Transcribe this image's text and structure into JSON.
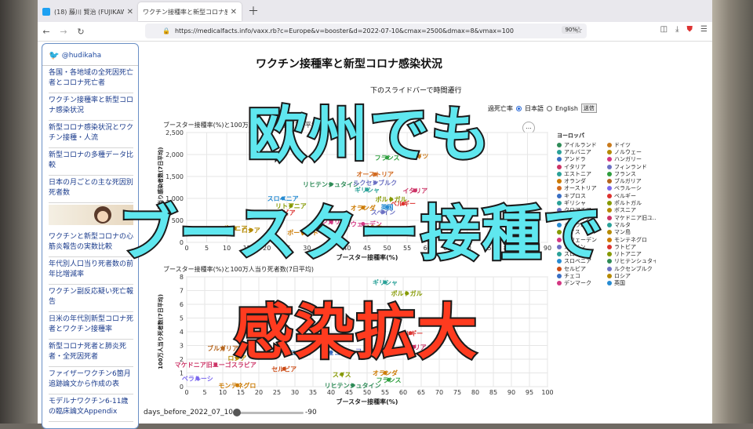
{
  "browser": {
    "tabs": [
      {
        "label": "(18) 藤川 賢治 (FUJIKAWA Kenji",
        "icon": "twitter-icon",
        "color": "#1da1f2"
      },
      {
        "label": "ワクチン接種率と新型コロナ感染状況",
        "icon": "page-icon",
        "color": "#888888"
      }
    ],
    "url": "https://medicalfacts.info/vaxx.rb?c=Europe&v=booster&d=2022-07-10&cmax=2500&dmax=8&vmax=100",
    "zoom": "90%"
  },
  "sidebar": {
    "twitter_handle": "@hudikaha",
    "links": [
      "各国・各地域の全死因死亡者とコロナ死亡者",
      "ワクチン接種率と新型コロナ感染状況",
      "新型コロナ感染状況とワクチン接種・人流",
      "新型コロナの多種データ比較",
      "日本の月ごとの主な死因別死者数",
      "ワクチンと新型コロナの心筋炎報告の実数比較",
      "年代別人口当り死者数の前年比増減率",
      "ワクチン副反応疑い死亡報告",
      "日米の年代別新型コロナ死者とワクチン接種率",
      "新型コロナ死者と肺炎死者・全死因死者",
      "ファイザーワクチン6箇月追跡論文から作成の表",
      "モデルナワクチン6-11歳の臨床論文Appendix"
    ]
  },
  "page": {
    "title": "ワクチン接種率と新型コロナ感染状況",
    "slider_caption": "下のスライドバーで時間遷行",
    "form_label": "過死亡率",
    "lang_ja": "日本語",
    "lang_en": "English",
    "submit": "送信",
    "slider_label": "days_before_2022_07_10",
    "slider_value": "-90",
    "slider_position": 0.0,
    "more_icon": "..."
  },
  "legend": {
    "title": "ヨーロッパ",
    "items": [
      {
        "name": "アイルランド",
        "color": "#2e8b57"
      },
      {
        "name": "ドイツ",
        "color": "#c97a1c"
      },
      {
        "name": "アルバニア",
        "color": "#2aa198"
      },
      {
        "name": "ノルウェー",
        "color": "#b58900"
      },
      {
        "name": "アンドラ",
        "color": "#3a6fc4"
      },
      {
        "name": "ハンガリー",
        "color": "#d33682"
      },
      {
        "name": "イタリア",
        "color": "#cc3366"
      },
      {
        "name": "フィンランド",
        "color": "#6c71c4"
      },
      {
        "name": "エストニア",
        "color": "#2aa198"
      },
      {
        "name": "フランス",
        "color": "#2e9e3e"
      },
      {
        "name": "オランダ",
        "color": "#cc7a00"
      },
      {
        "name": "ブルガリア",
        "color": "#b5651d"
      },
      {
        "name": "オーストリア",
        "color": "#d2691e"
      },
      {
        "name": "ベラルーシ",
        "color": "#7b68ee"
      },
      {
        "name": "キプロス",
        "color": "#3a6fc4"
      },
      {
        "name": "ベルギー",
        "color": "#dc322f"
      },
      {
        "name": "ギリシャ",
        "color": "#2aa198"
      },
      {
        "name": "ポルトガル",
        "color": "#859900"
      },
      {
        "name": "クロアチア",
        "color": "#6c71c4"
      },
      {
        "name": "ボスニア",
        "color": "#b58900"
      },
      {
        "name": "サンマリノ",
        "color": "#cb4b16"
      },
      {
        "name": "マケドニア旧ユ...",
        "color": "#cc3366"
      },
      {
        "name": "ジブラルタル",
        "color": "#268bd2"
      },
      {
        "name": "マルタ",
        "color": "#2aa198"
      },
      {
        "name": "スイス",
        "color": "#859900"
      },
      {
        "name": "マン島",
        "color": "#b58900"
      },
      {
        "name": "スウェーデン",
        "color": "#d33682"
      },
      {
        "name": "モンテネグロ",
        "color": "#cc7a00"
      },
      {
        "name": "スペイン",
        "color": "#6c71c4"
      },
      {
        "name": "ラトビア",
        "color": "#dc322f"
      },
      {
        "name": "スロバキア",
        "color": "#2aa198"
      },
      {
        "name": "リトアニア",
        "color": "#859900"
      },
      {
        "name": "スロベニア",
        "color": "#268bd2"
      },
      {
        "name": "リヒテンシュタイ...",
        "color": "#2e8b57"
      },
      {
        "name": "セルビア",
        "color": "#cb4b16"
      },
      {
        "name": "ルクセンブルク",
        "color": "#6c71c4"
      },
      {
        "name": "チェコ",
        "color": "#3a6fc4"
      },
      {
        "name": "ロシア",
        "color": "#b58900"
      },
      {
        "name": "デンマーク",
        "color": "#d33682"
      },
      {
        "name": "英国",
        "color": "#268bd2"
      }
    ]
  },
  "chart_data": [
    {
      "type": "scatter",
      "title": "ブースター接種率(%)と100万人当り感染者数(7日平均)",
      "xlabel": "ブースター接種率(%)",
      "ylabel": "100万人当り感染者数(7日平均)",
      "xlim": [
        0,
        90
      ],
      "ylim": [
        0,
        2500
      ],
      "xticks": [
        0,
        5,
        10,
        15,
        20,
        25,
        30,
        35,
        40,
        45,
        50,
        55,
        60,
        65,
        70,
        75,
        80,
        85,
        90
      ],
      "yticks": [
        0,
        500,
        1000,
        1500,
        2000,
        2500
      ],
      "grid": true,
      "points": [
        {
          "label": "フランス",
          "x": 50,
          "y": 1930,
          "color": "#2e9e3e"
        },
        {
          "label": "ドイツ",
          "x": 58,
          "y": 1960,
          "color": "#c97a1c"
        },
        {
          "label": "オーストリア",
          "x": 47,
          "y": 1550,
          "color": "#d2691e"
        },
        {
          "label": "リヒテンシュタイン",
          "x": 36,
          "y": 1320,
          "color": "#2e8b57"
        },
        {
          "label": "ルクセンブルク",
          "x": 47,
          "y": 1360,
          "color": "#6c71c4"
        },
        {
          "label": "ギリシャ",
          "x": 45,
          "y": 1200,
          "color": "#2aa198"
        },
        {
          "label": "イタリア",
          "x": 57,
          "y": 1180,
          "color": "#cc3366"
        },
        {
          "label": "ポルトガル",
          "x": 51,
          "y": 980,
          "color": "#859900"
        },
        {
          "label": "ベルギー",
          "x": 54,
          "y": 880,
          "color": "#dc322f"
        },
        {
          "label": "スロベニア",
          "x": 24,
          "y": 1000,
          "color": "#268bd2"
        },
        {
          "label": "リトアニア",
          "x": 26,
          "y": 830,
          "color": "#859900"
        },
        {
          "label": "オランダ",
          "x": 44,
          "y": 790,
          "color": "#cc7a00"
        },
        {
          "label": "英国",
          "x": 50,
          "y": 800,
          "color": "#268bd2"
        },
        {
          "label": "スペイン",
          "x": 49,
          "y": 690,
          "color": "#6c71c4"
        },
        {
          "label": "ハンガリー",
          "x": 36,
          "y": 470,
          "color": "#d33682"
        },
        {
          "label": "スウェーデン",
          "x": 44,
          "y": 420,
          "color": "#d33682"
        },
        {
          "label": "ノルウェー",
          "x": 48,
          "y": 340,
          "color": "#b58900"
        },
        {
          "label": "ラトビア",
          "x": 24,
          "y": 680,
          "color": "#dc322f"
        },
        {
          "label": "ボスニア",
          "x": 12,
          "y": 320,
          "color": "#b58900"
        },
        {
          "label": "ブルガリア",
          "x": 4,
          "y": 260,
          "color": "#b5651d"
        },
        {
          "label": "ロシア",
          "x": 16,
          "y": 280,
          "color": "#b58900"
        },
        {
          "label": "ポーランド",
          "x": 29,
          "y": 220,
          "color": "#cc7a00"
        }
      ]
    },
    {
      "type": "scatter",
      "title": "ブースター接種率(%)と100万人当り死者数(7日平均)",
      "xlabel": "ブースター接種率(%)",
      "ylabel": "100万人当り死者数(7日平均)",
      "xlim": [
        0,
        100
      ],
      "ylim": [
        0,
        8
      ],
      "xticks": [
        0,
        5,
        10,
        15,
        20,
        25,
        30,
        35,
        40,
        45,
        50,
        55,
        60,
        65,
        70,
        75,
        80,
        85,
        90,
        95,
        100
      ],
      "yticks": [
        0,
        1,
        2,
        3,
        4,
        5,
        6,
        7,
        8
      ],
      "grid": true,
      "points": [
        {
          "label": "ギリシャ",
          "x": 55,
          "y": 7.6,
          "color": "#2aa198"
        },
        {
          "label": "ポルトガル",
          "x": 61,
          "y": 6.8,
          "color": "#859900"
        },
        {
          "label": "ベルギー",
          "x": 62,
          "y": 3.9,
          "color": "#dc322f"
        },
        {
          "label": "イタリア",
          "x": 63,
          "y": 2.9,
          "color": "#cc3366"
        },
        {
          "label": "フィンランド",
          "x": 52,
          "y": 2.6,
          "color": "#6c71c4"
        },
        {
          "label": "ブルガリア",
          "x": 10,
          "y": 2.8,
          "color": "#b5651d"
        },
        {
          "label": "ロシア",
          "x": 14,
          "y": 2.1,
          "color": "#b58900"
        },
        {
          "label": "マケドニア旧ユーゴスラビア",
          "x": 8,
          "y": 1.6,
          "color": "#cc3366"
        },
        {
          "label": "スロベニア",
          "x": 31,
          "y": 2.5,
          "color": "#268bd2"
        },
        {
          "label": "チェコ",
          "x": 40,
          "y": 2.5,
          "color": "#3a6fc4"
        },
        {
          "label": "セルビア",
          "x": 27,
          "y": 1.3,
          "color": "#cb4b16"
        },
        {
          "label": "ベラルーシ",
          "x": 3,
          "y": 0.6,
          "color": "#7b68ee"
        },
        {
          "label": "モンテネグロ",
          "x": 14,
          "y": 0.1,
          "color": "#cc7a00"
        },
        {
          "label": "スイス",
          "x": 43,
          "y": 0.9,
          "color": "#859900"
        },
        {
          "label": "リヒテンシュタイン",
          "x": 46,
          "y": 0.1,
          "color": "#2e8b57"
        },
        {
          "label": "オランダ",
          "x": 55,
          "y": 1.0,
          "color": "#cc7a00"
        },
        {
          "label": "フランス",
          "x": 56,
          "y": 0.5,
          "color": "#2e9e3e"
        }
      ]
    }
  ],
  "overlay": {
    "line1": "欧州でも",
    "line2": "ブースター接種で",
    "line3": "感染拡大"
  }
}
